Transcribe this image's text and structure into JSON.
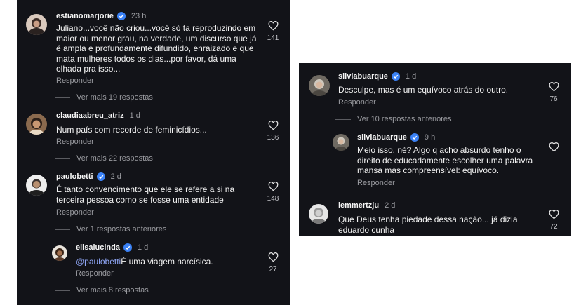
{
  "reply_label": "Responder",
  "left": {
    "c1": {
      "username": "estianomarjorie",
      "time": "23 h",
      "text": "Juliano...você não criou...você só ta reproduzindo em maior ou menor grau, na verdade, um discurso que já é ampla e profundamente difundido, enraizado e que mata mulheres todos os dias...por favor, dá uma olhada pra isso...",
      "likes": "141",
      "more": "Ver mais 19 respostas"
    },
    "c2": {
      "username": "claudiaabreu_atriz",
      "time": "1 d",
      "text": "Num país com recorde de feminicídios...",
      "likes": "136",
      "more": "Ver mais 22 respostas"
    },
    "c3": {
      "username": "paulobetti",
      "time": "2 d",
      "text": "É tanto convencimento que ele se refere a si na terceira pessoa como se fosse uma entidade",
      "likes": "148",
      "more": "Ver 1 respostas anteriores"
    },
    "c4": {
      "username": "elisalucinda",
      "time": "1 d",
      "mention": "@paulobetti",
      "text": "É uma viagem narcísica.",
      "likes": "27",
      "more": "Ver mais 8 respostas"
    }
  },
  "right": {
    "c1": {
      "username": "silviabuarque",
      "time": "1 d",
      "text": "Desculpe, mas é um equívoco atrás do outro.",
      "likes": "76",
      "more": "Ver 10 respostas anteriores"
    },
    "c2": {
      "username": "silviabuarque",
      "time": "9 h",
      "text": "Meio isso, né?  Algo q acho absurdo tenho o direito de educadamente escolher uma palavra mansa mas compreensível: equívoco."
    },
    "c3": {
      "username": "lemmertzju",
      "time": "2 d",
      "text": "Que Deus tenha piedade dessa nação... já dizia eduardo cunha",
      "likes": "72"
    }
  },
  "colors": {
    "panel_bg": "#121318",
    "verified_blue": "#3b82f6",
    "mention": "#8fa6f6",
    "muted": "#9a9ba0"
  }
}
